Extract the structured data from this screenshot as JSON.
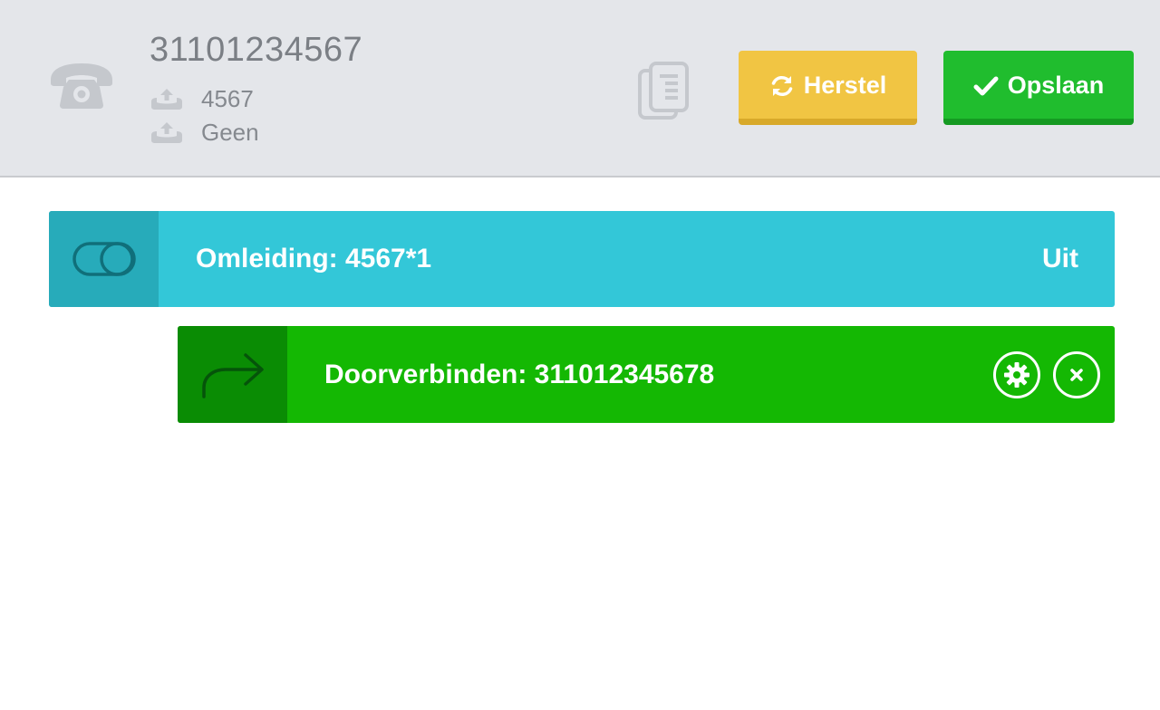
{
  "header": {
    "number": "31101234567",
    "extension": "4567",
    "secondary": "Geen",
    "icons": {
      "main": "phone-icon",
      "extension": "phone-transfer-icon",
      "secondary": "phone-transfer-icon",
      "copy": "copy-document-icon"
    }
  },
  "toolbar": {
    "reset_label": "Herstel",
    "reset_icon": "refresh-icon",
    "save_label": "Opslaan",
    "save_icon": "check-icon"
  },
  "rows": [
    {
      "label": "Omleiding: 4567*1",
      "status": "Uit",
      "icon": "toggle-icon",
      "color": "#33c7d8"
    },
    {
      "label": "Doorverbinden: 311012345678",
      "icon": "forward-arrow-icon",
      "actions": [
        "gear-icon",
        "close-icon"
      ],
      "color": "#14b803"
    }
  ],
  "colors": {
    "herstel": "#f1c543",
    "opslaan": "#20bd2e",
    "header_bg": "#e4e6ea"
  }
}
